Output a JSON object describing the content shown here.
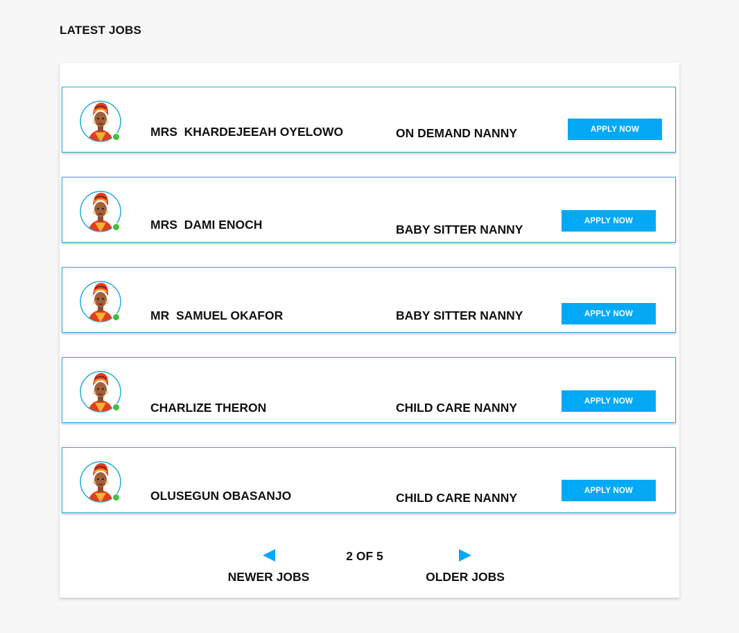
{
  "page": {
    "title": "LATEST JOBS"
  },
  "jobs": [
    {
      "name": "MRS  KHARDEJEEAH OYELOWO",
      "role": "ON DEMAND NANNY",
      "apply_label": "APPLY NOW",
      "status": "online"
    },
    {
      "name": "MRS  DAMI ENOCH",
      "role": "BABY SITTER NANNY",
      "apply_label": "APPLY NOW",
      "status": "online"
    },
    {
      "name": "MR  SAMUEL OKAFOR",
      "role": "BABY SITTER NANNY",
      "apply_label": "APPLY NOW",
      "status": "online"
    },
    {
      "name": "CHARLIZE THERON",
      "role": "CHILD CARE NANNY",
      "apply_label": "APPLY NOW",
      "status": "online"
    },
    {
      "name": "OLUSEGUN OBASANJO",
      "role": "CHILD CARE NANNY",
      "apply_label": "APPLY NOW",
      "status": "online"
    }
  ],
  "pagination": {
    "newer_label": "NEWER JOBS",
    "older_label": "OLDER JOBS",
    "page_indicator": "2 OF 5",
    "newer_icon": "triangle-left-icon",
    "older_icon": "triangle-right-icon"
  },
  "colors": {
    "accent": "#03a9f4",
    "card_border": "#26a9d9",
    "online": "#3fc13a"
  }
}
